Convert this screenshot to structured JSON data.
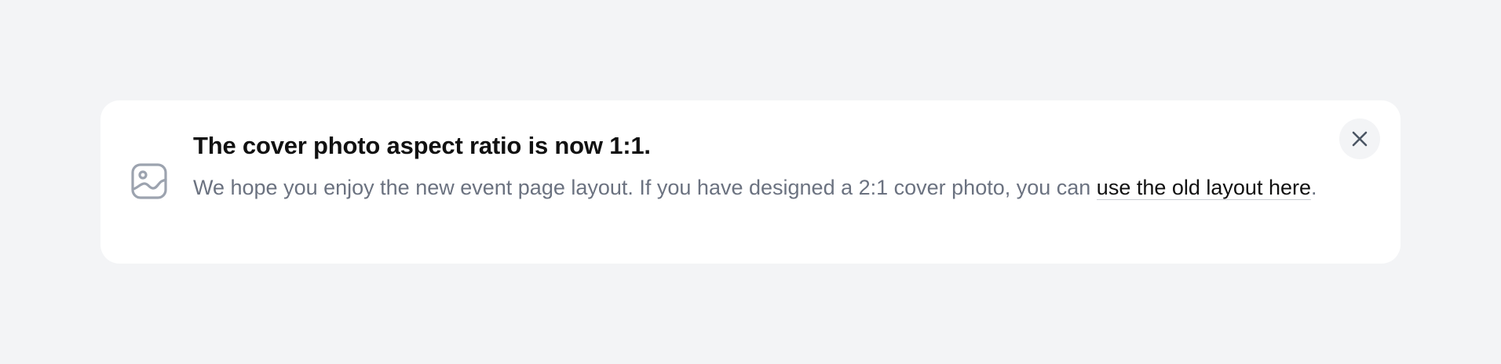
{
  "notice": {
    "icon": "image-icon",
    "title": "The cover photo aspect ratio is now 1:1.",
    "message": "We hope you enjoy the new event page layout. If you have designed a 2:1 cover photo, you can ",
    "link_label": "use the old layout here",
    "message_end": ".",
    "close_icon": "close-icon"
  },
  "colors": {
    "page_background": "#f3f4f6",
    "card_background": "#ffffff",
    "title": "#111111",
    "body_text": "#6b7280",
    "icon": "#9ca3af"
  }
}
